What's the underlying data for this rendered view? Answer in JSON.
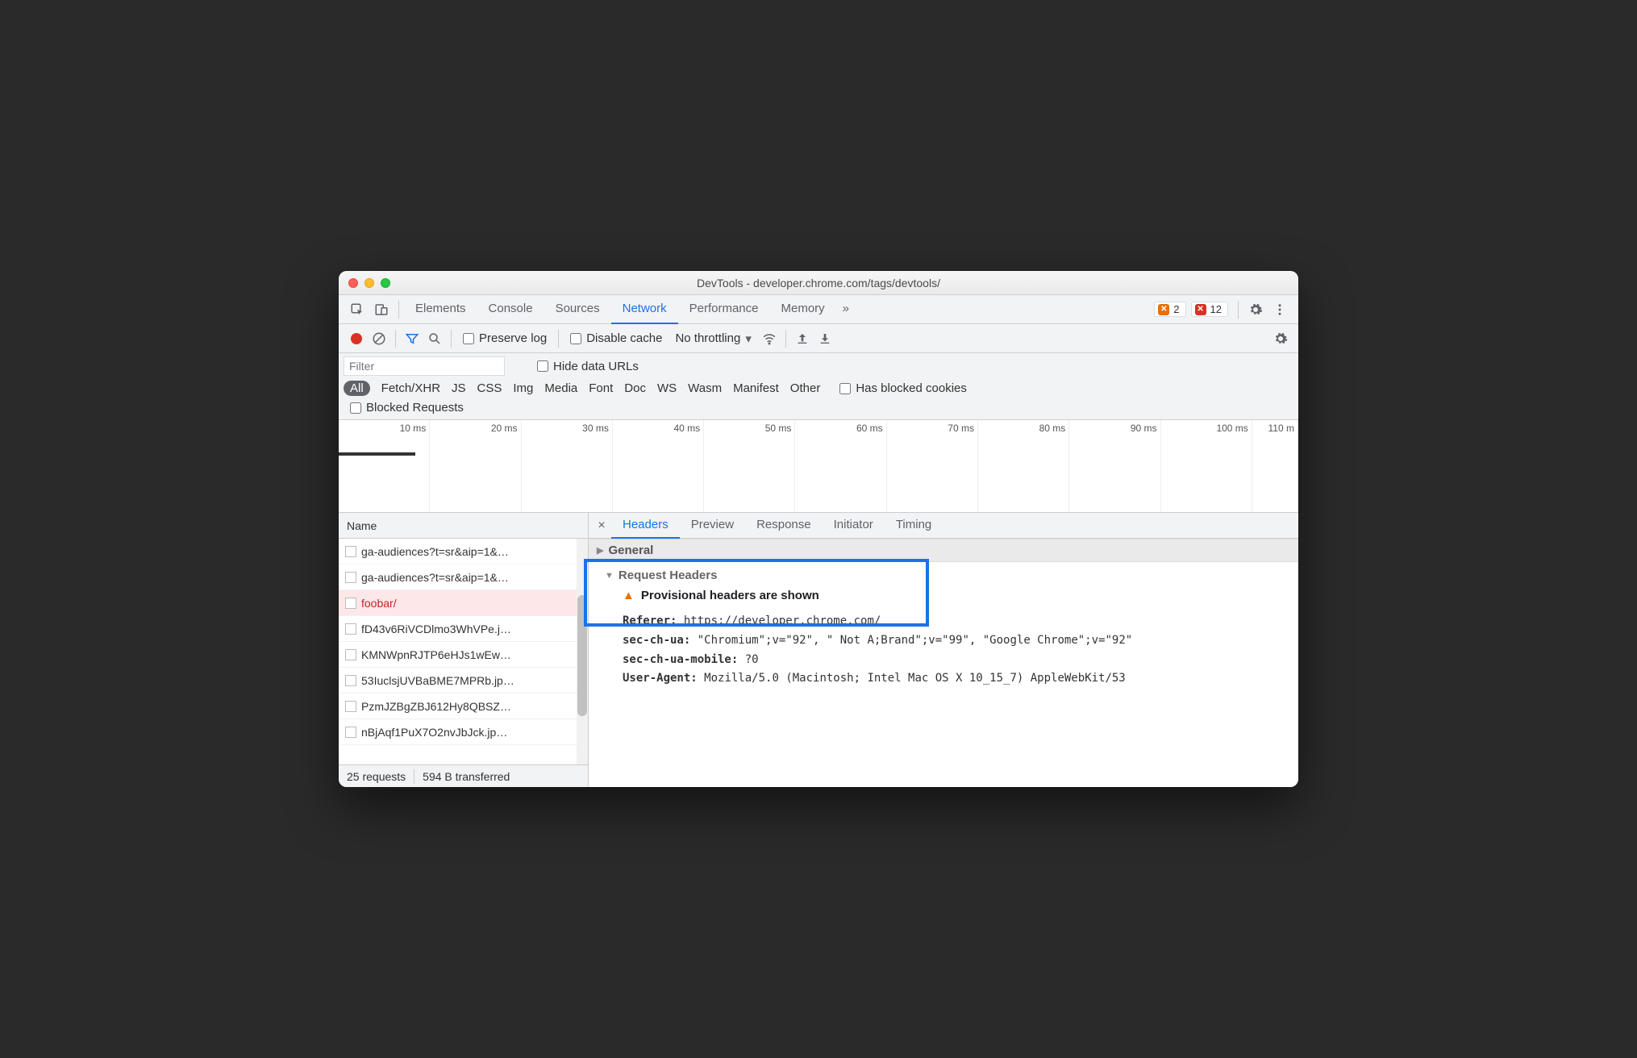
{
  "window": {
    "title": "DevTools - developer.chrome.com/tags/devtools/"
  },
  "tabs": {
    "items": [
      "Elements",
      "Console",
      "Sources",
      "Network",
      "Performance",
      "Memory"
    ],
    "active": "Network",
    "more": "»",
    "errors": "2",
    "issues": "12"
  },
  "toolbar": {
    "preserve_log": "Preserve log",
    "disable_cache": "Disable cache",
    "throttling": "No throttling"
  },
  "filter": {
    "placeholder": "Filter",
    "hide_data_urls": "Hide data URLs",
    "types": [
      "All",
      "Fetch/XHR",
      "JS",
      "CSS",
      "Img",
      "Media",
      "Font",
      "Doc",
      "WS",
      "Wasm",
      "Manifest",
      "Other"
    ],
    "active_type": "All",
    "has_blocked_cookies": "Has blocked cookies",
    "blocked_requests": "Blocked Requests"
  },
  "timeline": {
    "ticks": [
      "10 ms",
      "20 ms",
      "30 ms",
      "40 ms",
      "50 ms",
      "60 ms",
      "70 ms",
      "80 ms",
      "90 ms",
      "100 ms",
      "110 m"
    ]
  },
  "network": {
    "name_header": "Name",
    "rows": [
      {
        "name": "ga-audiences?t=sr&aip=1&…",
        "sel": false
      },
      {
        "name": "ga-audiences?t=sr&aip=1&…",
        "sel": false
      },
      {
        "name": "foobar/",
        "sel": true
      },
      {
        "name": "fD43v6RiVCDlmo3WhVPe.j…",
        "sel": false
      },
      {
        "name": "KMNWpnRJTP6eHJs1wEw…",
        "sel": false
      },
      {
        "name": "53IuclsjUVBaBME7MPRb.jp…",
        "sel": false
      },
      {
        "name": "PzmJZBgZBJ612Hy8QBSZ…",
        "sel": false
      },
      {
        "name": "nBjAqf1PuX7O2nvJbJck.jp…",
        "sel": false
      }
    ],
    "status": {
      "requests": "25 requests",
      "transferred": "594 B transferred"
    }
  },
  "details": {
    "tabs": [
      "Headers",
      "Preview",
      "Response",
      "Initiator",
      "Timing"
    ],
    "active": "Headers",
    "general_label": "General",
    "request_headers_label": "Request Headers",
    "provisional": "Provisional headers are shown",
    "headers": {
      "referer_k": "Referer:",
      "referer_v": "https://developer.chrome.com/",
      "secua_k": "sec-ch-ua:",
      "secua_v": "\"Chromium\";v=\"92\", \" Not A;Brand\";v=\"99\", \"Google Chrome\";v=\"92\"",
      "secmob_k": "sec-ch-ua-mobile:",
      "secmob_v": "?0",
      "ua_k": "User-Agent:",
      "ua_v": "Mozilla/5.0 (Macintosh; Intel Mac OS X 10_15_7) AppleWebKit/53"
    }
  }
}
